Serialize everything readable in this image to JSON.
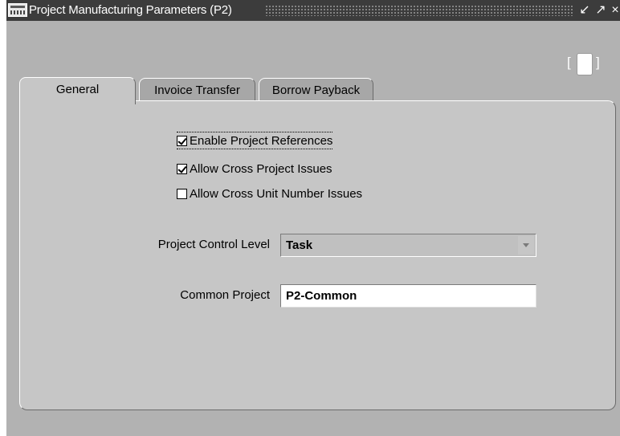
{
  "window": {
    "title": "Project Manufacturing Parameters (P2)",
    "app_icon": "oracle-forms-icon"
  },
  "titlebar_buttons": {
    "minimize": "↙",
    "maximize": "↗",
    "close": "×"
  },
  "tabs": [
    {
      "label": "General",
      "active": true
    },
    {
      "label": "Invoice Transfer",
      "active": false
    },
    {
      "label": "Borrow Payback",
      "active": false
    }
  ],
  "indicator": {
    "left_bracket": "[",
    "right_bracket": "]"
  },
  "general": {
    "checkboxes": [
      {
        "label": "Enable Project References",
        "checked": true
      },
      {
        "label": "Allow Cross Project Issues",
        "checked": true
      },
      {
        "label": "Allow Cross Unit Number Issues",
        "checked": false
      }
    ],
    "project_control_level": {
      "label": "Project Control Level",
      "value": "Task"
    },
    "common_project": {
      "label": "Common Project",
      "value": "P2-Common"
    }
  },
  "colors": {
    "titlebar": "#3c3c3c",
    "window_bg": "#b2b2b2",
    "panel_bg": "#c6c6c6",
    "inactive_tab": "#a7a7a7"
  }
}
